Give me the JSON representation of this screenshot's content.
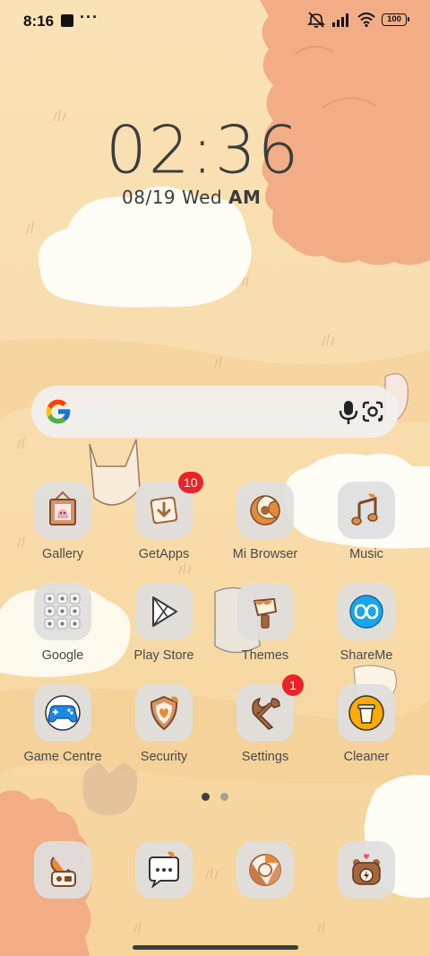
{
  "status_bar": {
    "time": "8:16",
    "dots": "···",
    "battery": "100",
    "icons": [
      "notification-square-icon",
      "mute-vibrate-icon",
      "signal-icon",
      "wifi-icon",
      "battery-icon"
    ]
  },
  "clock": {
    "time": "02:36",
    "date": "08/19",
    "day": "Wed",
    "ampm": "AM"
  },
  "search": {
    "icons": [
      "google-g-icon",
      "microphone-icon",
      "google-lens-icon"
    ]
  },
  "apps": [
    {
      "label": "Gallery",
      "icon": "gallery-frame-icon"
    },
    {
      "label": "GetApps",
      "icon": "getapps-download-icon",
      "badge": "10"
    },
    {
      "label": "Mi Browser",
      "icon": "browser-swirl-icon"
    },
    {
      "label": "Music",
      "icon": "music-note-icon"
    },
    {
      "label": "Google",
      "icon": "google-folder-icon"
    },
    {
      "label": "Play Store",
      "icon": "play-store-icon"
    },
    {
      "label": "Themes",
      "icon": "paint-brush-icon"
    },
    {
      "label": "ShareMe",
      "icon": "shareme-infinity-icon"
    },
    {
      "label": "Game Centre",
      "icon": "gamepad-icon"
    },
    {
      "label": "Security",
      "icon": "shield-icon"
    },
    {
      "label": "Settings",
      "icon": "wrench-icon",
      "badge": "1"
    },
    {
      "label": "Cleaner",
      "icon": "trash-bin-icon"
    }
  ],
  "dock": [
    {
      "icon": "phone-icon"
    },
    {
      "icon": "messages-icon"
    },
    {
      "icon": "chrome-icon"
    },
    {
      "icon": "camera-bear-icon"
    }
  ],
  "pages": {
    "count": 2,
    "active": 0
  },
  "colors": {
    "wallpaper": "#f8deae",
    "tree": "#f2ad86",
    "tile": "#dedede",
    "badge": "#e8232a",
    "accent_brown": "#a5663f",
    "accent_orange": "#e48a3a"
  }
}
